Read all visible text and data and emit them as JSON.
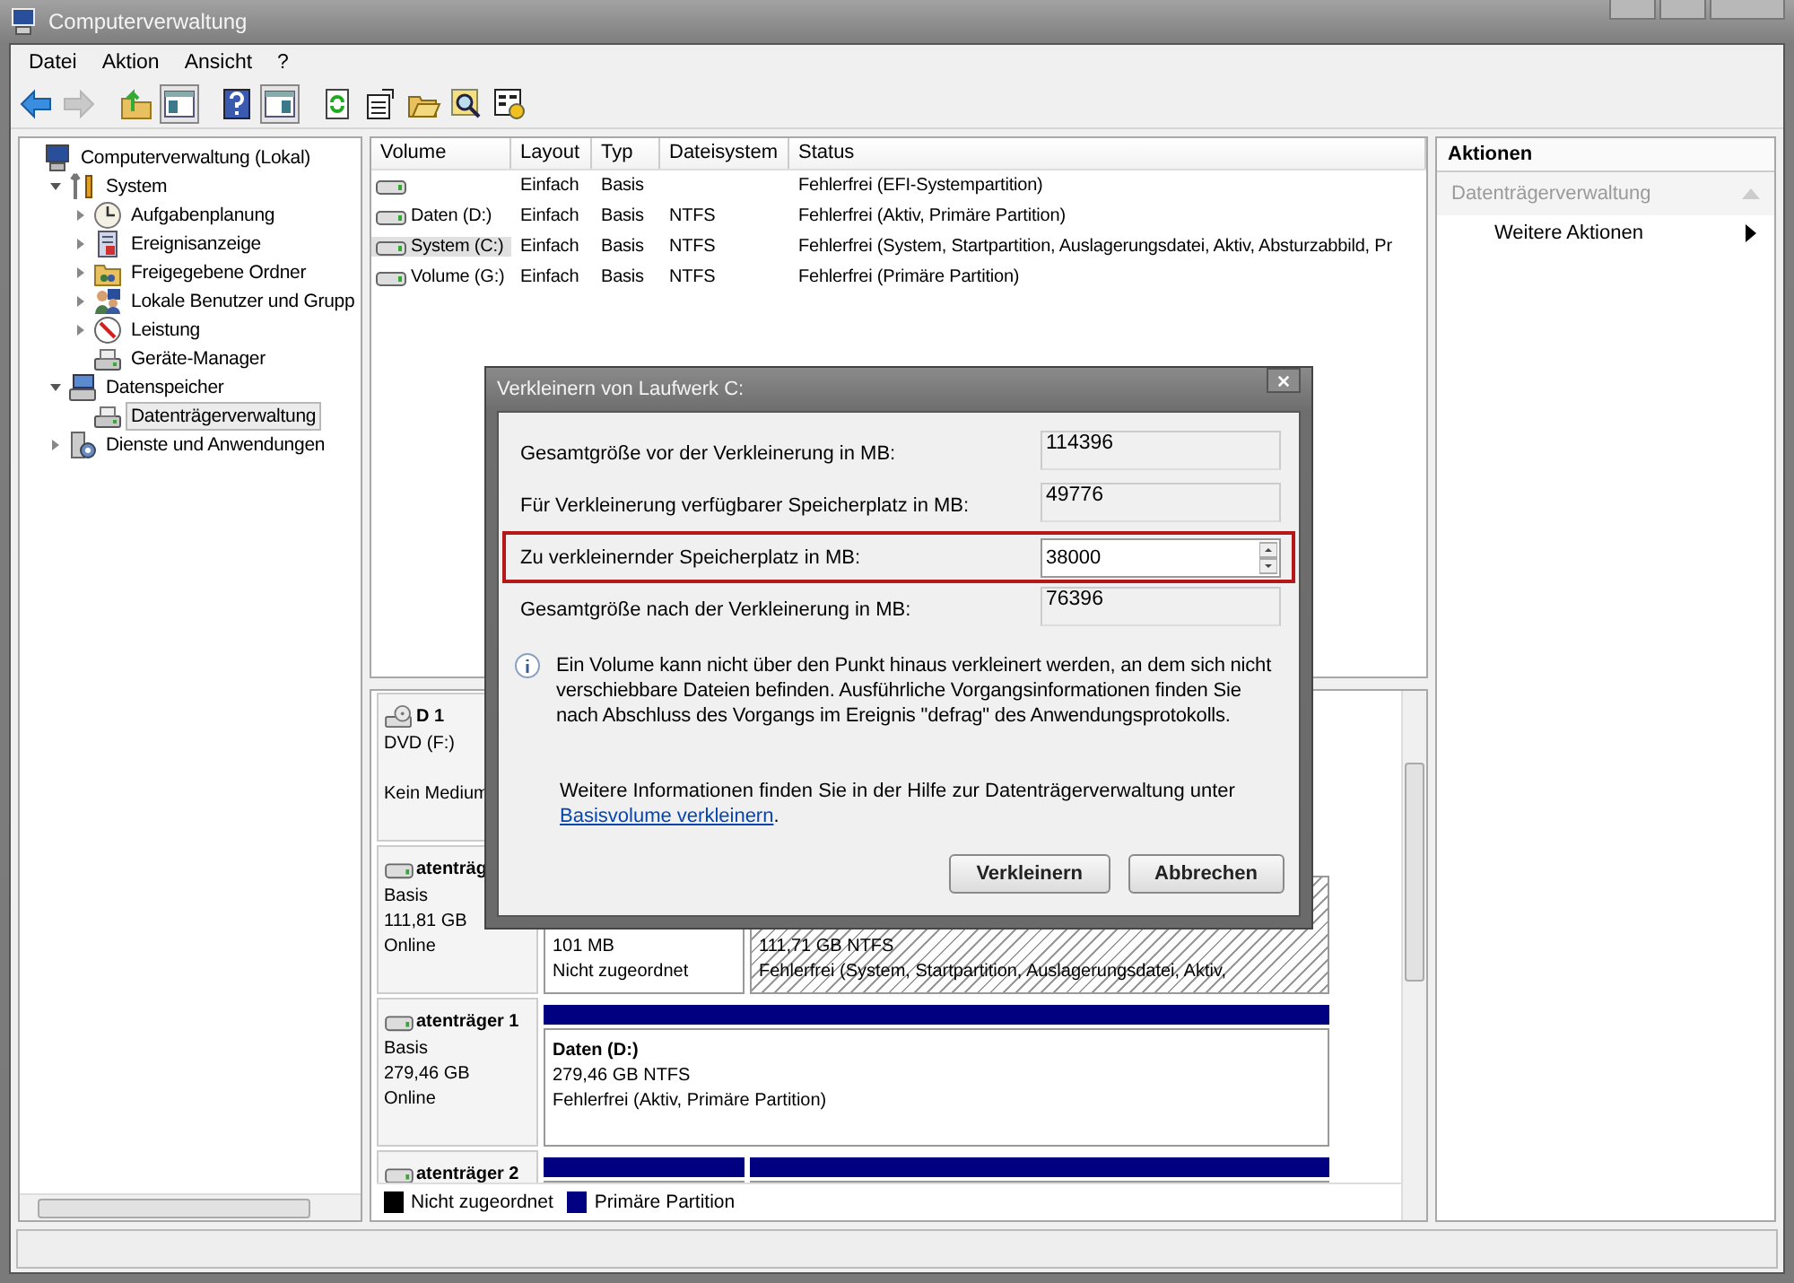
{
  "window": {
    "title": "Computerverwaltung"
  },
  "menu": [
    "Datei",
    "Aktion",
    "Ansicht",
    "?"
  ],
  "toolbar": [
    {
      "kind": "back",
      "disabled": false,
      "pressed": false
    },
    {
      "kind": "forward",
      "disabled": true,
      "pressed": false
    },
    {
      "kind": "up",
      "disabled": false,
      "pressed": false
    },
    {
      "kind": "tree",
      "disabled": false,
      "pressed": true
    },
    {
      "kind": "help",
      "disabled": false,
      "pressed": false
    },
    {
      "kind": "actionpane",
      "disabled": false,
      "pressed": true
    },
    {
      "kind": "refresh",
      "disabled": false,
      "pressed": false
    },
    {
      "kind": "properties",
      "disabled": false,
      "pressed": false
    },
    {
      "kind": "open",
      "disabled": false,
      "pressed": false
    },
    {
      "kind": "find",
      "disabled": false,
      "pressed": false
    },
    {
      "kind": "settings",
      "disabled": false,
      "pressed": false
    }
  ],
  "tree": [
    {
      "label": "Computerverwaltung (Lokal)",
      "kind": "computer",
      "selected": false,
      "children": [
        {
          "label": "System",
          "kind": "tools",
          "expanded": true,
          "selected": false,
          "children": [
            {
              "label": "Aufgabenplanung",
              "kind": "clock",
              "expanded": false,
              "selected": false
            },
            {
              "label": "Ereignisanzeige",
              "kind": "log",
              "expanded": false,
              "selected": false
            },
            {
              "label": "Freigegebene Ordner",
              "kind": "folder",
              "expanded": false,
              "selected": false
            },
            {
              "label": "Lokale Benutzer und Grupp",
              "kind": "users",
              "expanded": false,
              "selected": false
            },
            {
              "label": "Leistung",
              "kind": "gauge",
              "expanded": false,
              "selected": false
            },
            {
              "label": "Geräte-Manager",
              "kind": "device",
              "selected": false
            }
          ]
        },
        {
          "label": "Datenspeicher",
          "kind": "storage",
          "expanded": true,
          "selected": false,
          "children": [
            {
              "label": "Datenträgerverwaltung",
              "kind": "device",
              "selected": true
            }
          ]
        },
        {
          "label": "Dienste und Anwendungen",
          "kind": "services",
          "expanded": false,
          "selected": false
        }
      ]
    }
  ],
  "volumes": {
    "columns": [
      "Volume",
      "Layout",
      "Typ",
      "Dateisystem",
      "Status"
    ],
    "rows": [
      {
        "selected": false,
        "cells": [
          null,
          "Einfach",
          "Basis",
          null,
          "Fehlerfrei (EFI-Systempartition)"
        ]
      },
      {
        "selected": false,
        "cells": [
          "Daten (D:)",
          "Einfach",
          "Basis",
          "NTFS",
          "Fehlerfrei (Aktiv, Primäre Partition)"
        ]
      },
      {
        "selected": true,
        "cells": [
          "System (C:)",
          "Einfach",
          "Basis",
          "NTFS",
          "Fehlerfrei (System, Startpartition, Auslagerungsdatei, Aktiv, Absturzabbild, Pr"
        ]
      },
      {
        "selected": false,
        "cells": [
          "Volume (G:)",
          "Einfach",
          "Basis",
          "NTFS",
          "Fehlerfrei (Primäre Partition)"
        ]
      }
    ]
  },
  "disks": [
    {
      "kind": "cdrom",
      "name": "D 1",
      "type": "DVD (F:)",
      "status": "Kein Medium"
    },
    {
      "kind": "disk",
      "name": "atenträg",
      "type": "Basis",
      "size": "111,81 GB",
      "status": "Online",
      "partitions": [
        {
          "selected": false,
          "size": "101 MB",
          "status": "Nicht zugeordnet"
        },
        {
          "selected": true,
          "size": "111,71 GB NTFS",
          "status": "Fehlerfrei (System, Startpartition, Auslagerungsdatei, Aktiv,"
        }
      ]
    },
    {
      "kind": "disk",
      "name": "atenträger 1",
      "type": "Basis",
      "size": "279,46 GB",
      "status": "Online",
      "partitions": [
        {
          "kind": "primary",
          "selected": false,
          "name": "Daten (D:)",
          "size": "279,46 GB NTFS",
          "status": "Fehlerfrei (Aktiv, Primäre Partition)"
        }
      ]
    },
    {
      "kind": "disk",
      "name": "atenträger 2",
      "partitions": [
        {
          "kind": "primary"
        },
        {
          "kind": "primary"
        }
      ]
    }
  ],
  "legend": [
    {
      "kind": "unallocated",
      "label": "Nicht zugeordnet",
      "color": "#000000"
    },
    {
      "kind": "primary",
      "label": "Primäre Partition",
      "color": "#000080"
    }
  ],
  "actions": {
    "title": "Aktionen",
    "section": {
      "title": "Datenträgerverwaltung",
      "expanded": true,
      "disabled": true
    },
    "items": [
      {
        "label": "Weitere Aktionen",
        "submenu": true
      }
    ]
  },
  "dialog": {
    "title": "Verkleinern von Laufwerk C:",
    "fields": [
      {
        "label": "Gesamtgröße vor der Verkleinerung in MB:",
        "value": "114396",
        "kind": "readonly",
        "highlighted": false
      },
      {
        "label": "Für Verkleinerung verfügbarer Speicherplatz in MB:",
        "value": "49776",
        "kind": "readonly",
        "highlighted": false
      },
      {
        "label": "Zu verkleinernder Speicherplatz in MB:",
        "value": "38000",
        "kind": "spin",
        "highlighted": true
      },
      {
        "label": "Gesamtgröße nach der Verkleinerung in MB:",
        "value": "76396",
        "kind": "readonly",
        "highlighted": false
      }
    ],
    "info": "Ein Volume kann nicht über den Punkt hinaus verkleinert werden, an dem sich nicht verschiebbare Dateien befinden. Ausführliche Vorgangsinformationen finden Sie nach Abschluss des Vorgangs im Ereignis \"defrag\" des Anwendungsprotokolls.",
    "help_text": "Weitere Informationen finden Sie in der Hilfe zur Datenträgerverwaltung unter",
    "help_link": "Basisvolume verkleinern",
    "help_end": ".",
    "buttons": [
      "Verkleinern",
      "Abbrechen"
    ]
  }
}
